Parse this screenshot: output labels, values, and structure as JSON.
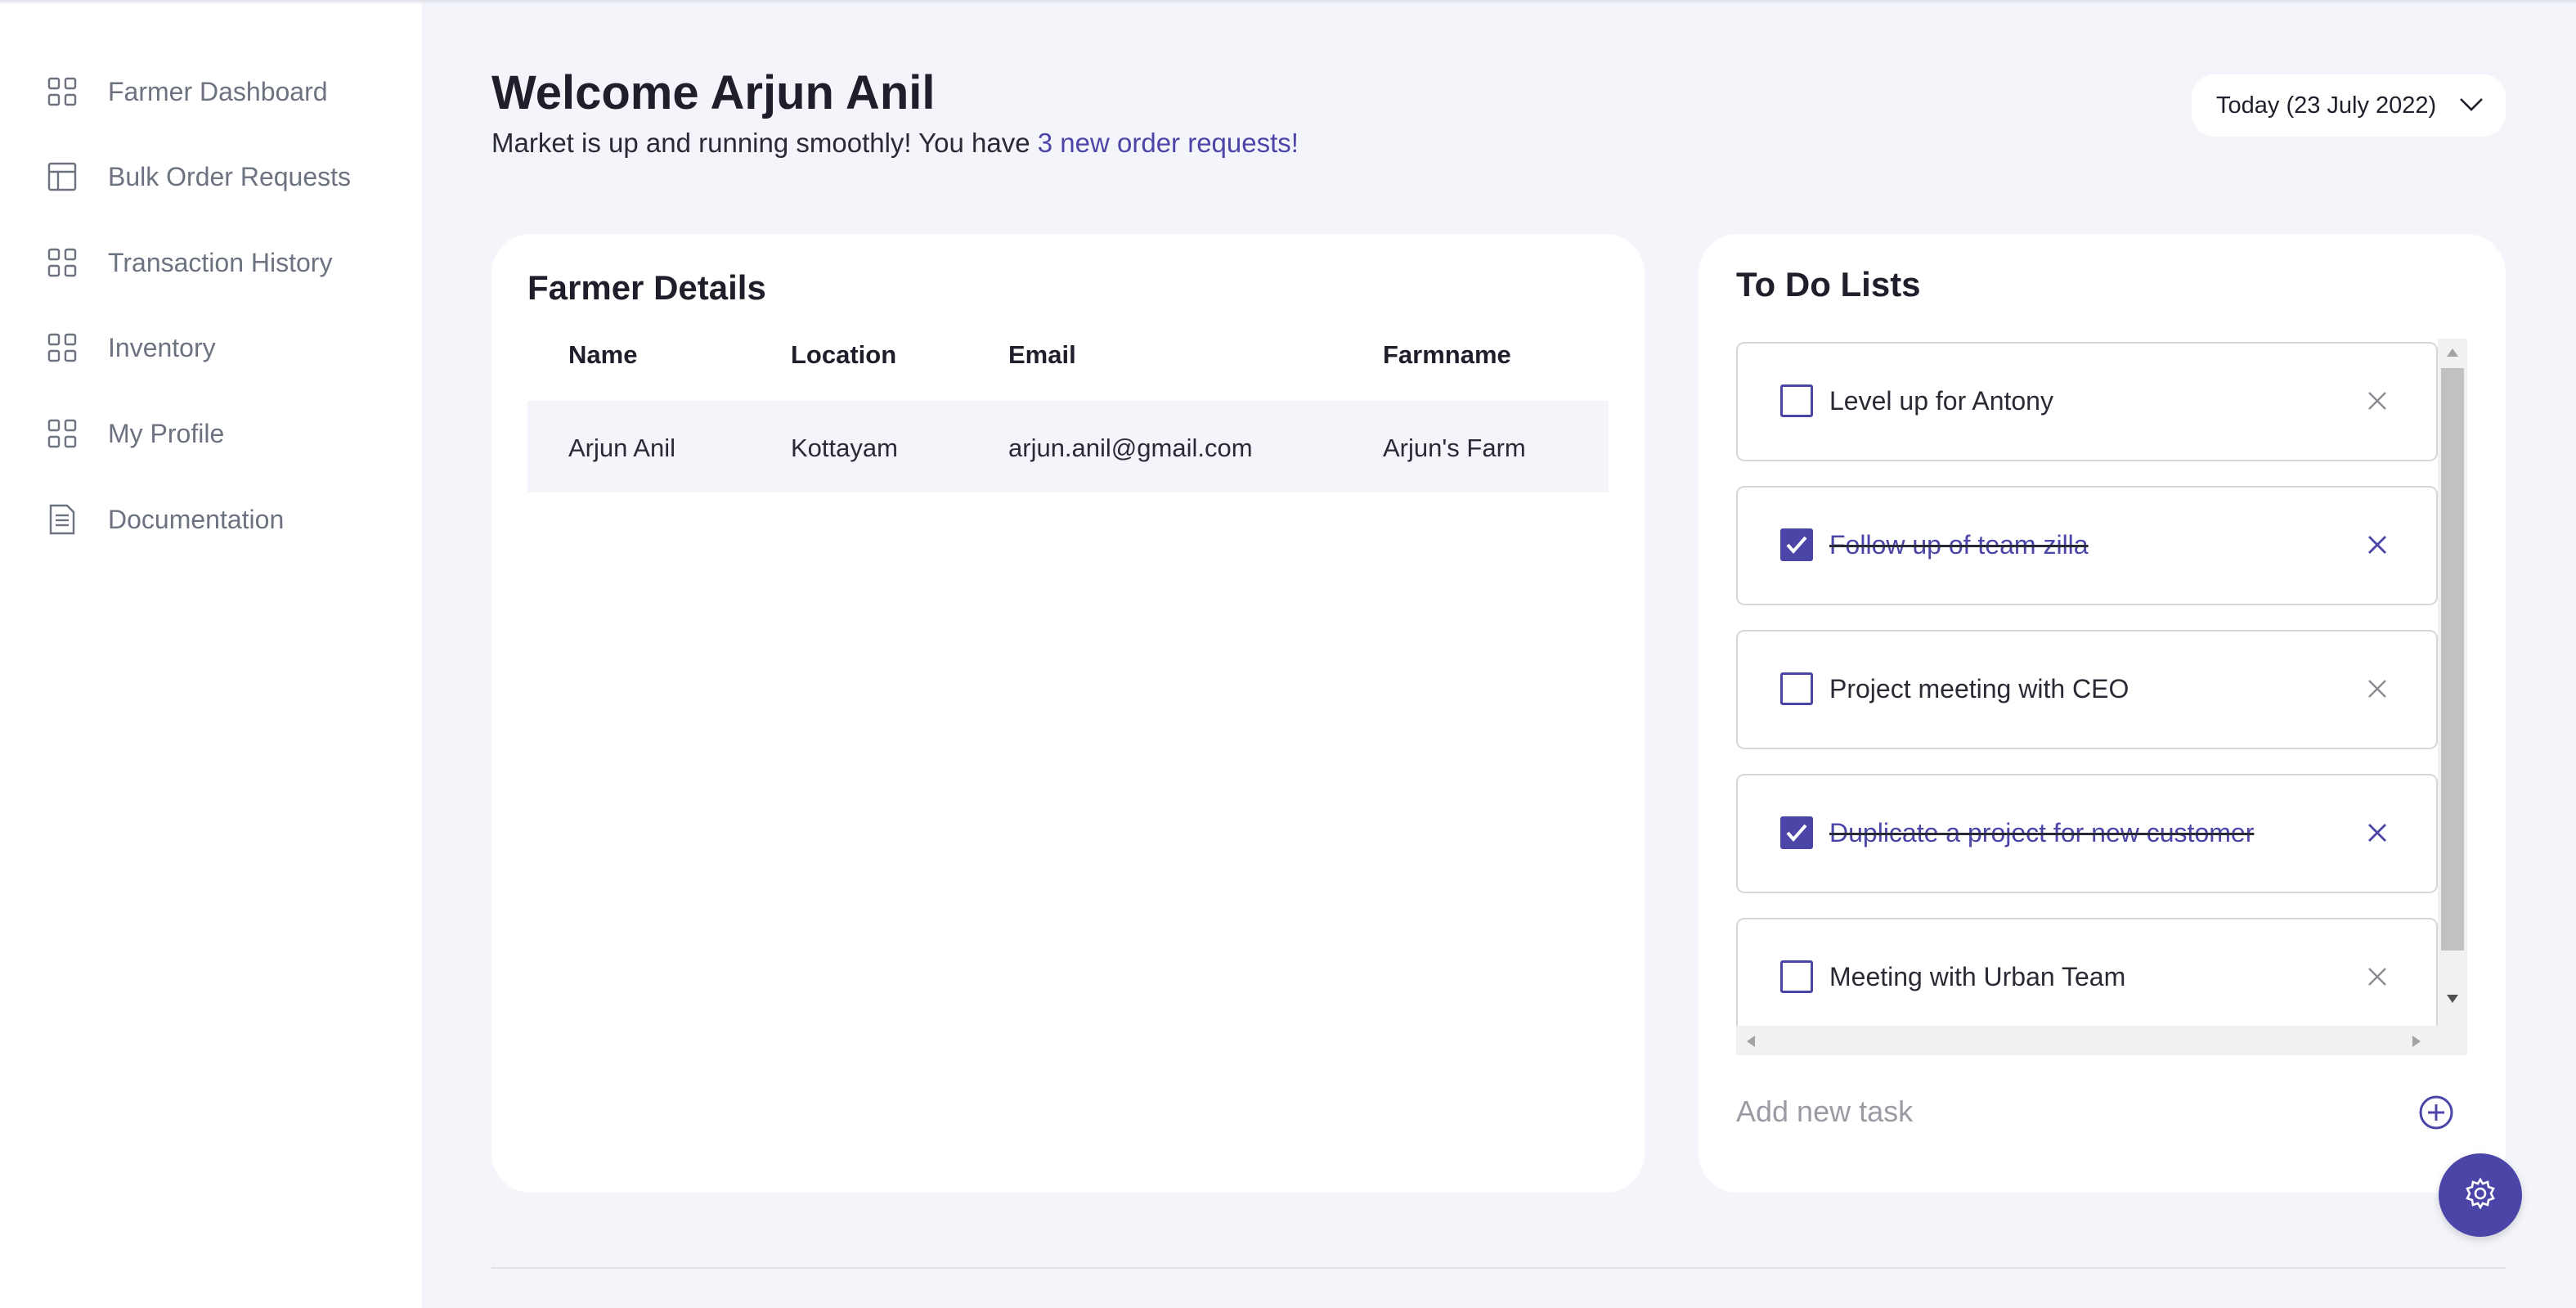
{
  "sidebar": {
    "items": [
      {
        "label": "Farmer Dashboard",
        "icon": "grid-icon"
      },
      {
        "label": "Bulk Order Requests",
        "icon": "layout-icon"
      },
      {
        "label": "Transaction History",
        "icon": "grid-icon"
      },
      {
        "label": "Inventory",
        "icon": "grid-icon"
      },
      {
        "label": "My Profile",
        "icon": "grid-icon"
      },
      {
        "label": "Documentation",
        "icon": "document-icon"
      }
    ]
  },
  "header": {
    "title": "Welcome Arjun Anil",
    "subtitle_prefix": "Market is up and running smoothly! You have ",
    "subtitle_link": "3 new order requests!",
    "date_selector": "Today (23 July 2022)"
  },
  "farmer_details": {
    "title": "Farmer Details",
    "columns": [
      "Name",
      "Location",
      "Email",
      "Farmname"
    ],
    "rows": [
      [
        "Arjun Anil",
        "Kottayam",
        "arjun.anil@gmail.com",
        "Arjun's Farm"
      ]
    ]
  },
  "todo": {
    "title": "To Do Lists",
    "items": [
      {
        "text": "Level up for Antony",
        "done": false
      },
      {
        "text": "Follow up of team zilla",
        "done": true
      },
      {
        "text": "Project meeting with CEO",
        "done": false
      },
      {
        "text": "Duplicate a project for new customer",
        "done": true
      },
      {
        "text": "Meeting with Urban Team",
        "done": false
      }
    ],
    "add_placeholder": "Add new task"
  },
  "colors": {
    "accent": "#4b45a8",
    "background": "#f4f5fb",
    "sidebar_text": "#6c7280"
  }
}
